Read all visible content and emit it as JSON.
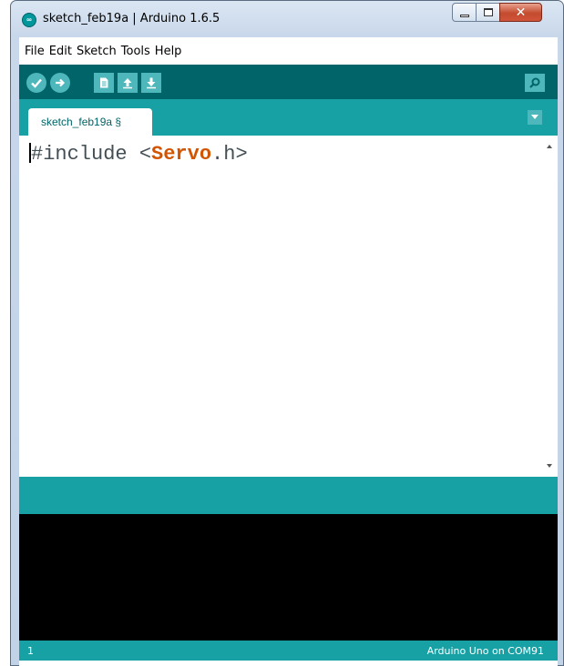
{
  "window": {
    "title": "sketch_feb19a | Arduino 1.6.5",
    "logo_text": "∞"
  },
  "menu": {
    "items": [
      "File",
      "Edit",
      "Sketch",
      "Tools",
      "Help"
    ]
  },
  "toolbar": {
    "buttons": [
      "verify-icon",
      "upload-icon",
      "new-icon",
      "open-icon",
      "save-icon",
      "serial-monitor-icon"
    ]
  },
  "tabs": {
    "active_label": "sketch_feb19a §"
  },
  "editor": {
    "directive": "#include ",
    "open_bracket": "<",
    "header_name": "Servo",
    "header_ext": ".h",
    "close_bracket": ">"
  },
  "status": {
    "line_number": "1",
    "board_port": "Arduino Uno on COM91"
  },
  "colors": {
    "toolbar": "#006468",
    "tabbar": "#17a1a5",
    "icon": "#4db7bb",
    "keyword": "#d35400"
  }
}
